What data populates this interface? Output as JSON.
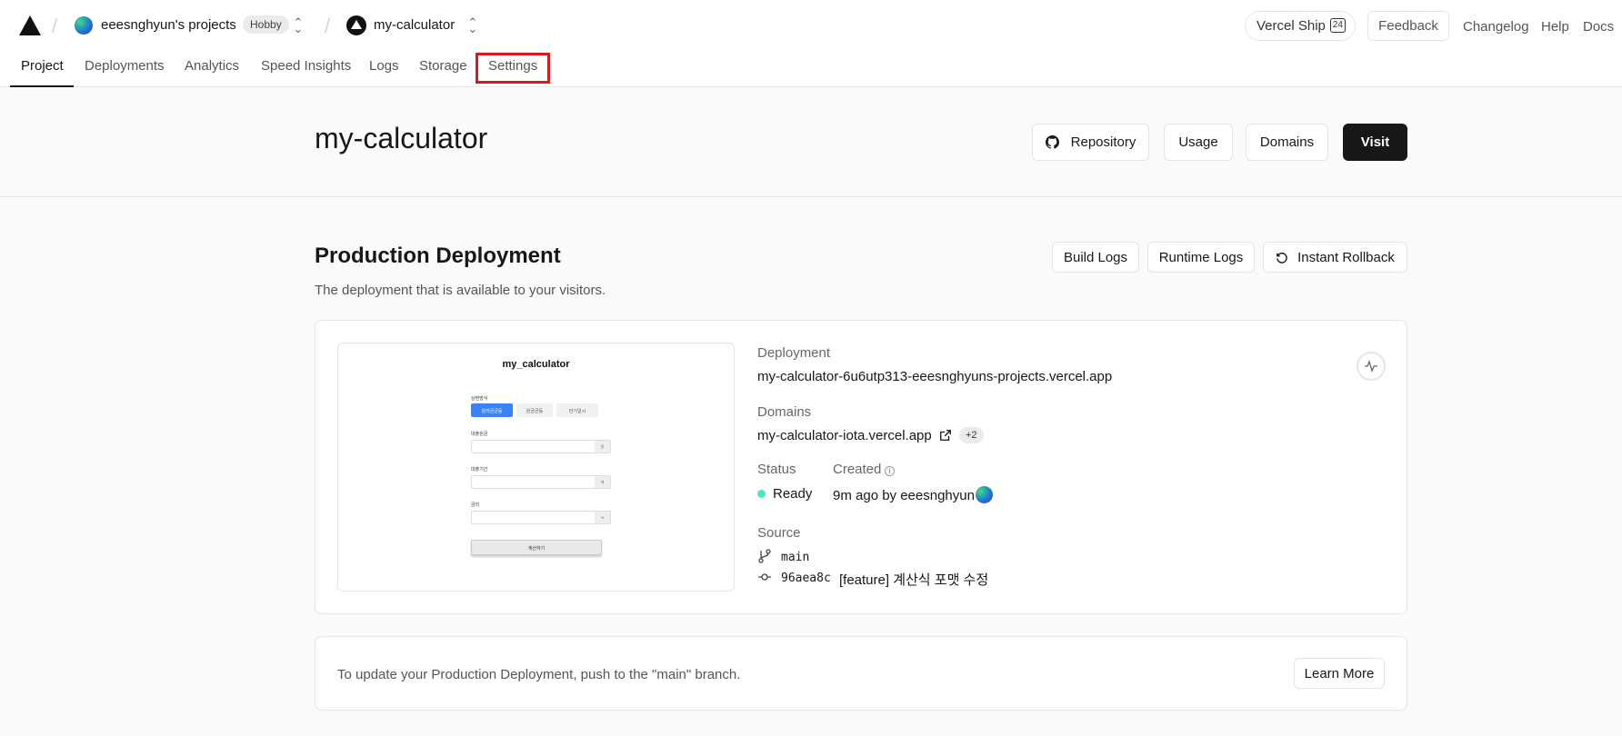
{
  "topbar": {
    "team_name": "eeesnghyun's projects",
    "team_plan": "Hobby",
    "project_name": "my-calculator",
    "ship_label": "Vercel Ship",
    "ship_badge": "24",
    "feedback": "Feedback",
    "changelog": "Changelog",
    "help": "Help",
    "docs": "Docs"
  },
  "tabs": [
    "Project",
    "Deployments",
    "Analytics",
    "Speed Insights",
    "Logs",
    "Storage",
    "Settings"
  ],
  "active_tab": "Project",
  "highlighted_tab": "Settings",
  "header": {
    "title": "my-calculator",
    "repository": "Repository",
    "usage": "Usage",
    "domains": "Domains",
    "visit": "Visit"
  },
  "production": {
    "title": "Production Deployment",
    "subtitle": "The deployment that is available to your visitors.",
    "build_logs": "Build Logs",
    "runtime_logs": "Runtime Logs",
    "instant_rollback": "Instant Rollback"
  },
  "preview": {
    "title": "my_calculator",
    "calc_label": "상환방식",
    "options": [
      "원리금균등",
      "원금균등",
      "만기일시"
    ],
    "field1_label": "대출원금",
    "field1_unit": "원",
    "field2_label": "대출기간",
    "field2_unit": "개",
    "field3_label": "금리",
    "field3_unit": "%",
    "button": "계산하기"
  },
  "deployment": {
    "deployment_label": "Deployment",
    "deployment_url": "my-calculator-6u6utp313-eeesnghyuns-projects.vercel.app",
    "domains_label": "Domains",
    "domain": "my-calculator-iota.vercel.app",
    "extra_domains": "+2",
    "status_label": "Status",
    "status": "Ready",
    "created_label": "Created",
    "created": "9m ago by eeesnghyun",
    "source_label": "Source",
    "branch": "main",
    "commit_hash": "96aea8c",
    "commit_message": "[feature] 계산식 포맷 수정"
  },
  "footer_card": {
    "text": "To update your Production Deployment, push to the \"main\" branch.",
    "learn_more": "Learn More"
  },
  "colors": {
    "accent": "#171717",
    "highlight": "#e0161f",
    "ready": "#50e3c2"
  }
}
